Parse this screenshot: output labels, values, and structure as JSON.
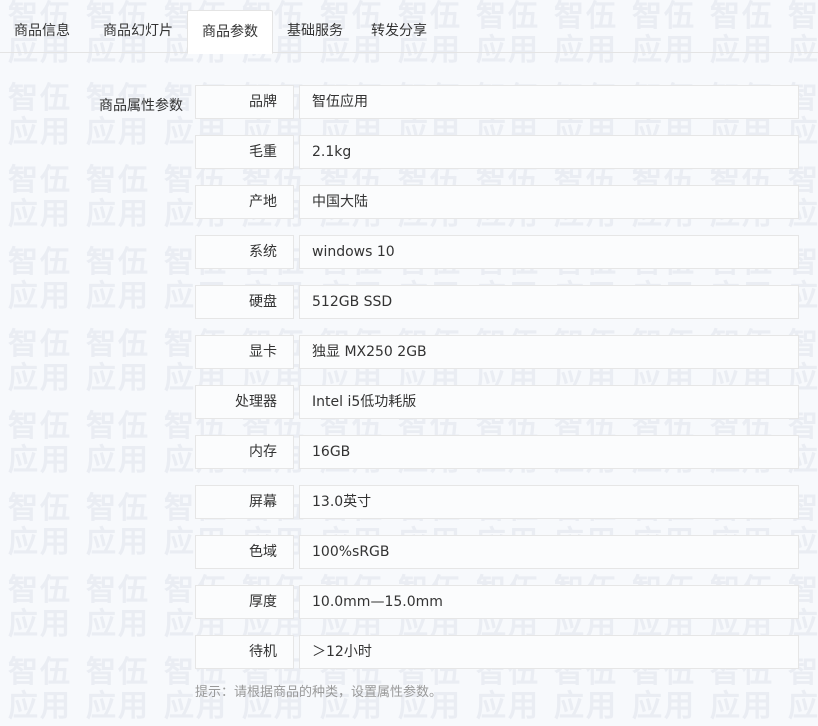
{
  "tabs": [
    {
      "label": "商品信息",
      "active": false
    },
    {
      "label": "商品幻灯片",
      "active": false
    },
    {
      "label": "商品参数",
      "active": true
    },
    {
      "label": "基础服务",
      "active": false
    },
    {
      "label": "转发分享",
      "active": false
    }
  ],
  "form": {
    "label": "商品属性参数",
    "rows": [
      {
        "key": "品牌",
        "value": "智伍应用"
      },
      {
        "key": "毛重",
        "value": "2.1kg"
      },
      {
        "key": "产地",
        "value": "中国大陆"
      },
      {
        "key": "系统",
        "value": "windows 10"
      },
      {
        "key": "硬盘",
        "value": "512GB SSD"
      },
      {
        "key": "显卡",
        "value": "独显 MX250 2GB"
      },
      {
        "key": "处理器",
        "value": "Intel i5低功耗版"
      },
      {
        "key": "内存",
        "value": "16GB"
      },
      {
        "key": "屏幕",
        "value": "13.0英寸"
      },
      {
        "key": "色域",
        "value": "100%sRGB"
      },
      {
        "key": "厚度",
        "value": "10.0mm—15.0mm"
      },
      {
        "key": "待机",
        "value": "＞12小时"
      }
    ],
    "hint": "提示：请根据商品的种类，设置属性参数。"
  },
  "watermark": {
    "text_top": "智伍",
    "text_bottom": "应用"
  },
  "colors": {
    "border": "#e6e6e6",
    "hint": "#999999",
    "text": "#333333"
  }
}
